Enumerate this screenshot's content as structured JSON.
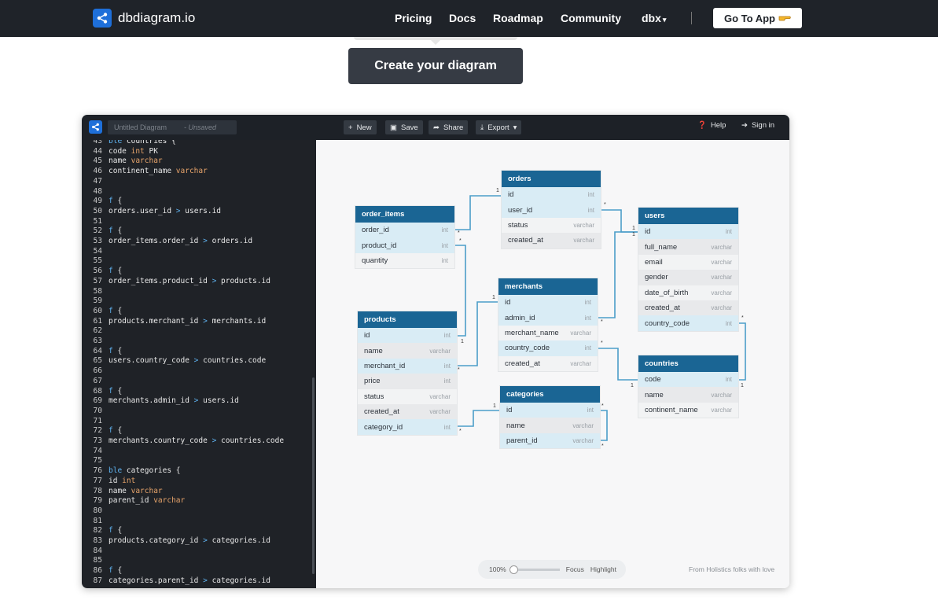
{
  "site": {
    "brand": "dbdiagram.io",
    "nav": [
      "Pricing",
      "Docs",
      "Roadmap",
      "Community",
      "dbx"
    ],
    "goto_label": "Go To App",
    "cta_label": "Create your diagram"
  },
  "app": {
    "title_placeholder": "Untitled Diagram",
    "unsaved_label": "- Unsaved",
    "toolbar": {
      "new": "New",
      "save": "Save",
      "share": "Share",
      "export": "Export",
      "help": "Help",
      "signin": "Sign in"
    }
  },
  "editor_lines": [
    {
      "n": "43",
      "parts": [
        [
          "kw",
          "ble "
        ],
        [
          "",
          "countries {"
        ]
      ]
    },
    {
      "n": "44",
      "parts": [
        [
          "",
          "code "
        ],
        [
          "ty",
          "int"
        ],
        [
          "",
          " PK"
        ]
      ]
    },
    {
      "n": "45",
      "parts": [
        [
          "",
          "name "
        ],
        [
          "ty",
          "varchar"
        ]
      ]
    },
    {
      "n": "46",
      "parts": [
        [
          "",
          "continent_name "
        ],
        [
          "ty",
          "varchar"
        ]
      ]
    },
    {
      "n": "47",
      "parts": []
    },
    {
      "n": "48",
      "parts": []
    },
    {
      "n": "49",
      "parts": [
        [
          "kw",
          "f"
        ],
        [
          "",
          " {"
        ]
      ]
    },
    {
      "n": "50",
      "parts": [
        [
          "",
          "orders.user_id "
        ],
        [
          "kw",
          ">"
        ],
        [
          "",
          " users.id"
        ]
      ]
    },
    {
      "n": "51",
      "parts": []
    },
    {
      "n": "52",
      "parts": [
        [
          "kw",
          "f"
        ],
        [
          "",
          " {"
        ]
      ]
    },
    {
      "n": "53",
      "parts": [
        [
          "",
          "order_items.order_id "
        ],
        [
          "kw",
          ">"
        ],
        [
          "",
          " orders.id"
        ]
      ]
    },
    {
      "n": "54",
      "parts": []
    },
    {
      "n": "55",
      "parts": []
    },
    {
      "n": "56",
      "parts": [
        [
          "kw",
          "f"
        ],
        [
          "",
          " {"
        ]
      ]
    },
    {
      "n": "57",
      "parts": [
        [
          "",
          "order_items.product_id "
        ],
        [
          "kw",
          ">"
        ],
        [
          "",
          " products.id"
        ]
      ]
    },
    {
      "n": "58",
      "parts": []
    },
    {
      "n": "59",
      "parts": []
    },
    {
      "n": "60",
      "parts": [
        [
          "kw",
          "f"
        ],
        [
          "",
          " {"
        ]
      ]
    },
    {
      "n": "61",
      "parts": [
        [
          "",
          "products.merchant_id "
        ],
        [
          "kw",
          ">"
        ],
        [
          "",
          " merchants.id"
        ]
      ]
    },
    {
      "n": "62",
      "parts": []
    },
    {
      "n": "63",
      "parts": []
    },
    {
      "n": "64",
      "parts": [
        [
          "kw",
          "f"
        ],
        [
          "",
          " {"
        ]
      ]
    },
    {
      "n": "65",
      "parts": [
        [
          "",
          "users.country_code "
        ],
        [
          "kw",
          ">"
        ],
        [
          "",
          " countries.code"
        ]
      ]
    },
    {
      "n": "66",
      "parts": []
    },
    {
      "n": "67",
      "parts": []
    },
    {
      "n": "68",
      "parts": [
        [
          "kw",
          "f"
        ],
        [
          "",
          " {"
        ]
      ]
    },
    {
      "n": "69",
      "parts": [
        [
          "",
          "merchants.admin_id "
        ],
        [
          "kw",
          ">"
        ],
        [
          "",
          " users.id"
        ]
      ]
    },
    {
      "n": "70",
      "parts": []
    },
    {
      "n": "71",
      "parts": []
    },
    {
      "n": "72",
      "parts": [
        [
          "kw",
          "f"
        ],
        [
          "",
          " {"
        ]
      ]
    },
    {
      "n": "73",
      "parts": [
        [
          "",
          "merchants.country_code "
        ],
        [
          "kw",
          ">"
        ],
        [
          "",
          " countries.code"
        ]
      ]
    },
    {
      "n": "74",
      "parts": []
    },
    {
      "n": "75",
      "parts": []
    },
    {
      "n": "76",
      "parts": [
        [
          "kw",
          "ble "
        ],
        [
          "",
          "categories {"
        ]
      ]
    },
    {
      "n": "77",
      "parts": [
        [
          "",
          "id "
        ],
        [
          "ty",
          "int"
        ]
      ]
    },
    {
      "n": "78",
      "parts": [
        [
          "",
          "name "
        ],
        [
          "ty",
          "varchar"
        ]
      ]
    },
    {
      "n": "79",
      "parts": [
        [
          "",
          "parent_id "
        ],
        [
          "ty",
          "varchar"
        ]
      ]
    },
    {
      "n": "80",
      "parts": []
    },
    {
      "n": "81",
      "parts": []
    },
    {
      "n": "82",
      "parts": [
        [
          "kw",
          "f"
        ],
        [
          "",
          " {"
        ]
      ]
    },
    {
      "n": "83",
      "parts": [
        [
          "",
          "products.category_id "
        ],
        [
          "kw",
          ">"
        ],
        [
          "",
          " categories.id"
        ]
      ]
    },
    {
      "n": "84",
      "parts": []
    },
    {
      "n": "85",
      "parts": []
    },
    {
      "n": "86",
      "parts": [
        [
          "kw",
          "f"
        ],
        [
          "",
          " {"
        ]
      ]
    },
    {
      "n": "87",
      "parts": [
        [
          "",
          "categories.parent_id "
        ],
        [
          "kw",
          ">"
        ],
        [
          "",
          " categories.id"
        ]
      ]
    }
  ],
  "tables": {
    "order_items": {
      "name": "order_items",
      "fields": [
        [
          "order_id",
          "int"
        ],
        [
          "product_id",
          "int"
        ],
        [
          "quantity",
          "int"
        ]
      ]
    },
    "orders": {
      "name": "orders",
      "fields": [
        [
          "id",
          "int"
        ],
        [
          "user_id",
          "int"
        ],
        [
          "status",
          "varchar"
        ],
        [
          "created_at",
          "varchar"
        ]
      ]
    },
    "users": {
      "name": "users",
      "fields": [
        [
          "id",
          "int"
        ],
        [
          "full_name",
          "varchar"
        ],
        [
          "email",
          "varchar"
        ],
        [
          "gender",
          "varchar"
        ],
        [
          "date_of_birth",
          "varchar"
        ],
        [
          "created_at",
          "varchar"
        ],
        [
          "country_code",
          "int"
        ]
      ]
    },
    "merchants": {
      "name": "merchants",
      "fields": [
        [
          "id",
          "int"
        ],
        [
          "admin_id",
          "int"
        ],
        [
          "merchant_name",
          "varchar"
        ],
        [
          "country_code",
          "int"
        ],
        [
          "created_at",
          "varchar"
        ]
      ]
    },
    "products": {
      "name": "products",
      "fields": [
        [
          "id",
          "int"
        ],
        [
          "name",
          "varchar"
        ],
        [
          "merchant_id",
          "int"
        ],
        [
          "price",
          "int"
        ],
        [
          "status",
          "varchar"
        ],
        [
          "created_at",
          "varchar"
        ],
        [
          "category_id",
          "int"
        ]
      ]
    },
    "countries": {
      "name": "countries",
      "fields": [
        [
          "code",
          "int"
        ],
        [
          "name",
          "varchar"
        ],
        [
          "continent_name",
          "varchar"
        ]
      ]
    },
    "categories": {
      "name": "categories",
      "fields": [
        [
          "id",
          "int"
        ],
        [
          "name",
          "varchar"
        ],
        [
          "parent_id",
          "varchar"
        ]
      ]
    }
  },
  "zoom": {
    "level": "100%",
    "focus": "Focus",
    "highlight": "Highlight"
  },
  "credit": "From Holistics folks with love"
}
